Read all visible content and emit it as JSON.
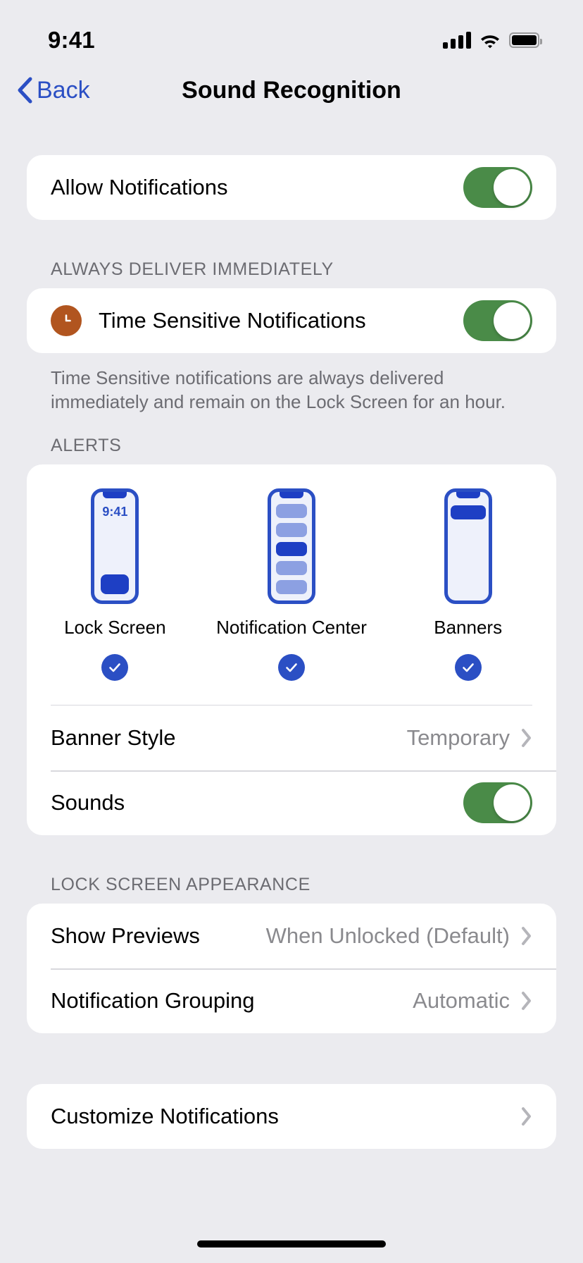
{
  "status_bar": {
    "time": "9:41",
    "cellular_icon": "signal-bars-icon",
    "wifi_icon": "wifi-icon",
    "battery_icon": "battery-icon"
  },
  "nav": {
    "back_label": "Back",
    "back_icon": "chevron-left-icon",
    "title": "Sound Recognition"
  },
  "allow_section": {
    "label": "Allow Notifications",
    "toggle_on": true
  },
  "time_sensitive_section": {
    "header": "ALWAYS DELIVER IMMEDIATELY",
    "icon": "clock-icon",
    "label": "Time Sensitive Notifications",
    "toggle_on": true,
    "footer": "Time Sensitive notifications are always delivered immediately and remain on the Lock Screen for an hour."
  },
  "alerts_section": {
    "header": "ALERTS",
    "previews": [
      {
        "name": "Lock Screen",
        "phone_time": "9:41",
        "checked": true
      },
      {
        "name": "Notification Center",
        "checked": true
      },
      {
        "name": "Banners",
        "checked": true
      }
    ],
    "banner_style": {
      "label": "Banner Style",
      "value": "Temporary"
    },
    "sounds": {
      "label": "Sounds",
      "toggle_on": true
    }
  },
  "lock_screen_appearance": {
    "header": "LOCK SCREEN APPEARANCE",
    "rows": [
      {
        "label": "Show Previews",
        "value": "When Unlocked (Default)"
      },
      {
        "label": "Notification Grouping",
        "value": "Automatic"
      }
    ]
  },
  "customize_section": {
    "label": "Customize Notifications"
  },
  "colors": {
    "background": "#EBEBEF",
    "card": "#FFFFFF",
    "accent_blue": "#2B4FC4",
    "toggle_green": "#4A8B48",
    "clock_orange": "#B1551F",
    "secondary_text": "#8A8A8E",
    "header_text": "#6C6C72"
  }
}
